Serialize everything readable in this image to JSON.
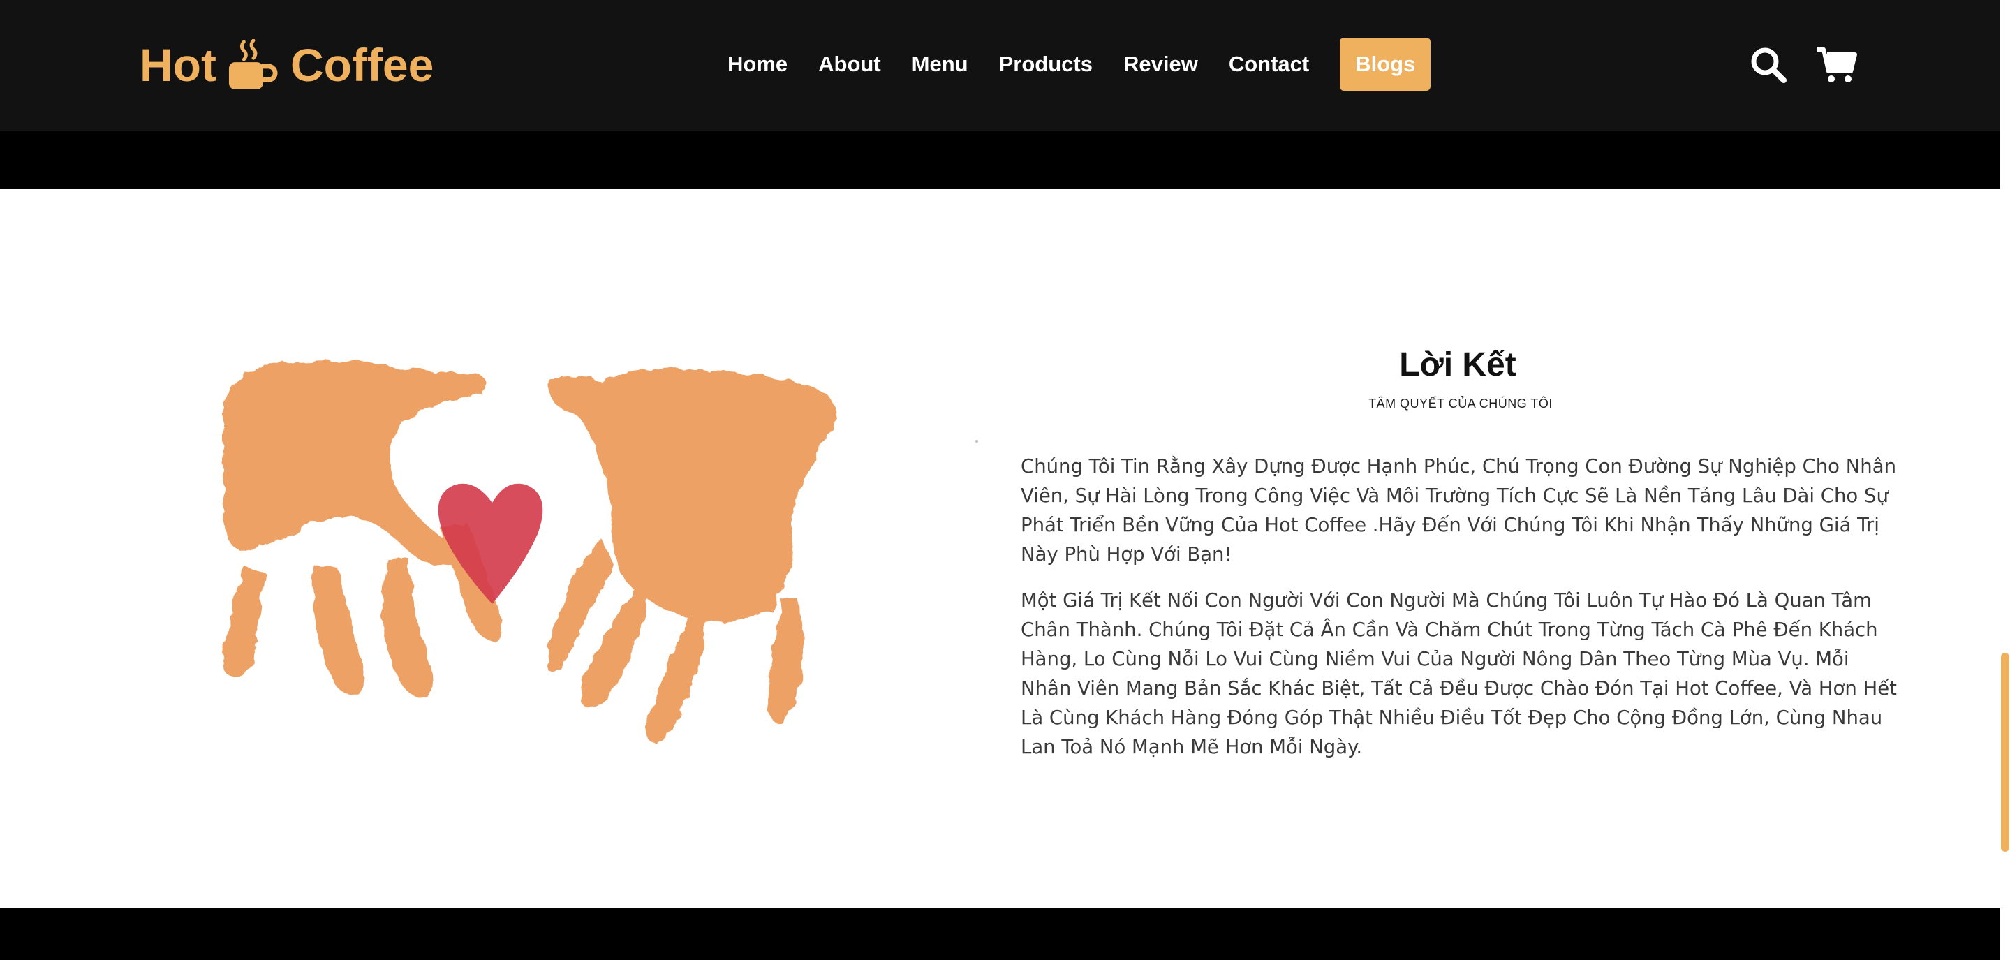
{
  "header": {
    "logo": {
      "left": "Hot",
      "right": "Coffee",
      "icon": "coffee-cup-icon"
    },
    "nav": [
      {
        "label": "Home"
      },
      {
        "label": "About"
      },
      {
        "label": "Menu"
      },
      {
        "label": "Products"
      },
      {
        "label": "Review"
      },
      {
        "label": "Contact"
      },
      {
        "label": "Blogs",
        "active": true
      }
    ],
    "icons": [
      "search-icon",
      "shopping-cart-icon"
    ]
  },
  "closing": {
    "image": "painted-handprints-with-heart",
    "title": "Lời Kết",
    "subtitle": "TÂM QUYẾT CỦA CHÚNG TÔI",
    "paragraphs": [
      "Chúng Tôi Tin Rằng Xây Dựng Được Hạnh Phúc, Chú Trọng Con Đường Sự Nghiệp Cho Nhân Viên, Sự Hài Lòng Trong Công Việc Và Môi Trường Tích Cực Sẽ Là Nền Tảng Lâu Dài Cho Sự Phát Triển Bền Vững Của Hot Coffee .Hãy Đến Với Chúng Tôi Khi Nhận Thấy Những Giá Trị Này Phù Hợp Với Bạn!",
      "Một Giá Trị Kết Nối Con Người Với Con Người Mà Chúng Tôi Luôn Tự Hào Đó Là Quan Tâm Chân Thành. Chúng Tôi Đặt Cả Ân Cần Và Chăm Chút Trong Từng Tách Cà Phê Đến Khách Hàng, Lo Cùng Nỗi Lo Vui Cùng Niềm Vui Của Người Nông Dân Theo Từng Mùa Vụ. Mỗi Nhân Viên Mang Bản Sắc Khác Biệt, Tất Cả Đều Được Chào Đón Tại Hot Coffee, Và Hơn Hết Là Cùng Khách Hàng Đóng Góp Thật Nhiều Điều Tốt Đẹp Cho Cộng Đồng Lớn, Cùng Nhau Lan Toả Nó Mạnh Mẽ Hơn Mỗi Ngày."
    ]
  },
  "colors": {
    "accent": "#f0b15e",
    "header_bg": "#121212",
    "page_bg": "#000000",
    "section_bg": "#ffffff",
    "paint": "#ec9a58",
    "heart": "#d33a4a"
  }
}
